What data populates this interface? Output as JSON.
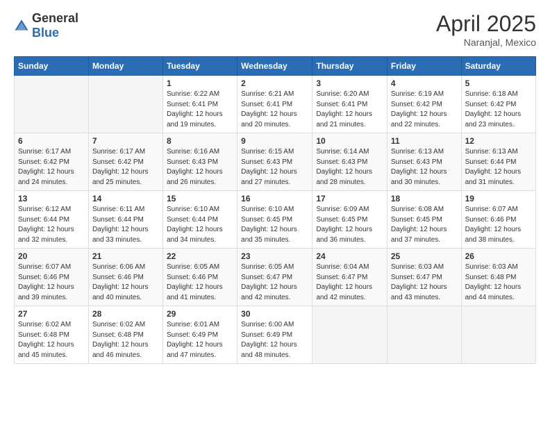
{
  "header": {
    "logo_general": "General",
    "logo_blue": "Blue",
    "month_year": "April 2025",
    "location": "Naranjal, Mexico"
  },
  "weekdays": [
    "Sunday",
    "Monday",
    "Tuesday",
    "Wednesday",
    "Thursday",
    "Friday",
    "Saturday"
  ],
  "weeks": [
    [
      {
        "day": "",
        "sunrise": "",
        "sunset": "",
        "daylight": ""
      },
      {
        "day": "",
        "sunrise": "",
        "sunset": "",
        "daylight": ""
      },
      {
        "day": "1",
        "sunrise": "Sunrise: 6:22 AM",
        "sunset": "Sunset: 6:41 PM",
        "daylight": "Daylight: 12 hours and 19 minutes."
      },
      {
        "day": "2",
        "sunrise": "Sunrise: 6:21 AM",
        "sunset": "Sunset: 6:41 PM",
        "daylight": "Daylight: 12 hours and 20 minutes."
      },
      {
        "day": "3",
        "sunrise": "Sunrise: 6:20 AM",
        "sunset": "Sunset: 6:41 PM",
        "daylight": "Daylight: 12 hours and 21 minutes."
      },
      {
        "day": "4",
        "sunrise": "Sunrise: 6:19 AM",
        "sunset": "Sunset: 6:42 PM",
        "daylight": "Daylight: 12 hours and 22 minutes."
      },
      {
        "day": "5",
        "sunrise": "Sunrise: 6:18 AM",
        "sunset": "Sunset: 6:42 PM",
        "daylight": "Daylight: 12 hours and 23 minutes."
      }
    ],
    [
      {
        "day": "6",
        "sunrise": "Sunrise: 6:17 AM",
        "sunset": "Sunset: 6:42 PM",
        "daylight": "Daylight: 12 hours and 24 minutes."
      },
      {
        "day": "7",
        "sunrise": "Sunrise: 6:17 AM",
        "sunset": "Sunset: 6:42 PM",
        "daylight": "Daylight: 12 hours and 25 minutes."
      },
      {
        "day": "8",
        "sunrise": "Sunrise: 6:16 AM",
        "sunset": "Sunset: 6:43 PM",
        "daylight": "Daylight: 12 hours and 26 minutes."
      },
      {
        "day": "9",
        "sunrise": "Sunrise: 6:15 AM",
        "sunset": "Sunset: 6:43 PM",
        "daylight": "Daylight: 12 hours and 27 minutes."
      },
      {
        "day": "10",
        "sunrise": "Sunrise: 6:14 AM",
        "sunset": "Sunset: 6:43 PM",
        "daylight": "Daylight: 12 hours and 28 minutes."
      },
      {
        "day": "11",
        "sunrise": "Sunrise: 6:13 AM",
        "sunset": "Sunset: 6:43 PM",
        "daylight": "Daylight: 12 hours and 30 minutes."
      },
      {
        "day": "12",
        "sunrise": "Sunrise: 6:13 AM",
        "sunset": "Sunset: 6:44 PM",
        "daylight": "Daylight: 12 hours and 31 minutes."
      }
    ],
    [
      {
        "day": "13",
        "sunrise": "Sunrise: 6:12 AM",
        "sunset": "Sunset: 6:44 PM",
        "daylight": "Daylight: 12 hours and 32 minutes."
      },
      {
        "day": "14",
        "sunrise": "Sunrise: 6:11 AM",
        "sunset": "Sunset: 6:44 PM",
        "daylight": "Daylight: 12 hours and 33 minutes."
      },
      {
        "day": "15",
        "sunrise": "Sunrise: 6:10 AM",
        "sunset": "Sunset: 6:44 PM",
        "daylight": "Daylight: 12 hours and 34 minutes."
      },
      {
        "day": "16",
        "sunrise": "Sunrise: 6:10 AM",
        "sunset": "Sunset: 6:45 PM",
        "daylight": "Daylight: 12 hours and 35 minutes."
      },
      {
        "day": "17",
        "sunrise": "Sunrise: 6:09 AM",
        "sunset": "Sunset: 6:45 PM",
        "daylight": "Daylight: 12 hours and 36 minutes."
      },
      {
        "day": "18",
        "sunrise": "Sunrise: 6:08 AM",
        "sunset": "Sunset: 6:45 PM",
        "daylight": "Daylight: 12 hours and 37 minutes."
      },
      {
        "day": "19",
        "sunrise": "Sunrise: 6:07 AM",
        "sunset": "Sunset: 6:46 PM",
        "daylight": "Daylight: 12 hours and 38 minutes."
      }
    ],
    [
      {
        "day": "20",
        "sunrise": "Sunrise: 6:07 AM",
        "sunset": "Sunset: 6:46 PM",
        "daylight": "Daylight: 12 hours and 39 minutes."
      },
      {
        "day": "21",
        "sunrise": "Sunrise: 6:06 AM",
        "sunset": "Sunset: 6:46 PM",
        "daylight": "Daylight: 12 hours and 40 minutes."
      },
      {
        "day": "22",
        "sunrise": "Sunrise: 6:05 AM",
        "sunset": "Sunset: 6:46 PM",
        "daylight": "Daylight: 12 hours and 41 minutes."
      },
      {
        "day": "23",
        "sunrise": "Sunrise: 6:05 AM",
        "sunset": "Sunset: 6:47 PM",
        "daylight": "Daylight: 12 hours and 42 minutes."
      },
      {
        "day": "24",
        "sunrise": "Sunrise: 6:04 AM",
        "sunset": "Sunset: 6:47 PM",
        "daylight": "Daylight: 12 hours and 42 minutes."
      },
      {
        "day": "25",
        "sunrise": "Sunrise: 6:03 AM",
        "sunset": "Sunset: 6:47 PM",
        "daylight": "Daylight: 12 hours and 43 minutes."
      },
      {
        "day": "26",
        "sunrise": "Sunrise: 6:03 AM",
        "sunset": "Sunset: 6:48 PM",
        "daylight": "Daylight: 12 hours and 44 minutes."
      }
    ],
    [
      {
        "day": "27",
        "sunrise": "Sunrise: 6:02 AM",
        "sunset": "Sunset: 6:48 PM",
        "daylight": "Daylight: 12 hours and 45 minutes."
      },
      {
        "day": "28",
        "sunrise": "Sunrise: 6:02 AM",
        "sunset": "Sunset: 6:48 PM",
        "daylight": "Daylight: 12 hours and 46 minutes."
      },
      {
        "day": "29",
        "sunrise": "Sunrise: 6:01 AM",
        "sunset": "Sunset: 6:49 PM",
        "daylight": "Daylight: 12 hours and 47 minutes."
      },
      {
        "day": "30",
        "sunrise": "Sunrise: 6:00 AM",
        "sunset": "Sunset: 6:49 PM",
        "daylight": "Daylight: 12 hours and 48 minutes."
      },
      {
        "day": "",
        "sunrise": "",
        "sunset": "",
        "daylight": ""
      },
      {
        "day": "",
        "sunrise": "",
        "sunset": "",
        "daylight": ""
      },
      {
        "day": "",
        "sunrise": "",
        "sunset": "",
        "daylight": ""
      }
    ]
  ]
}
